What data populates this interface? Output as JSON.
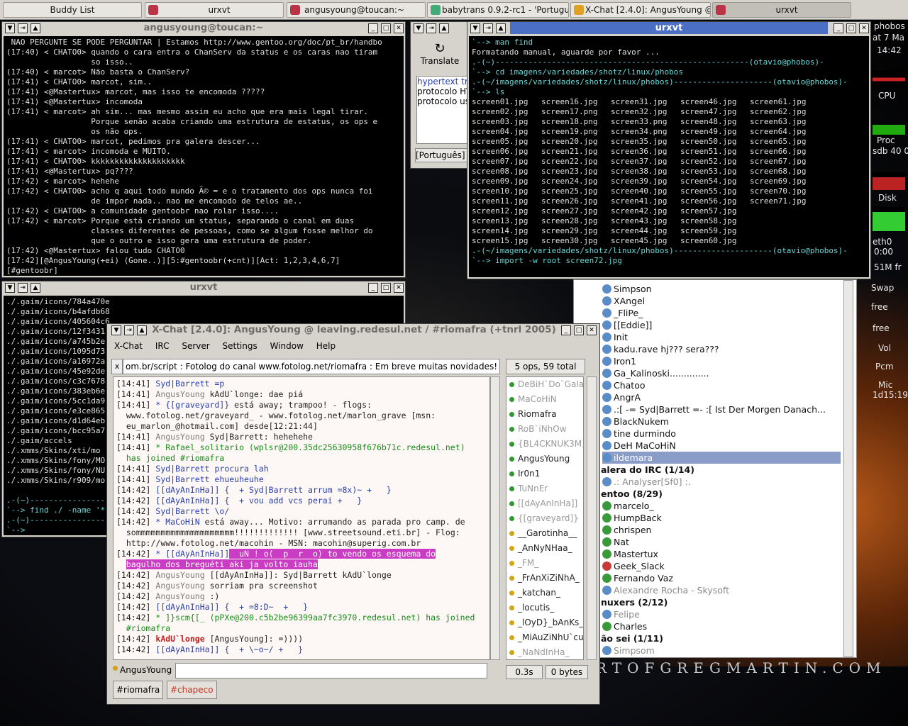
{
  "taskbar": {
    "tasks": [
      "Buddy List",
      "urxvt",
      "angusyoung@toucan:~",
      "babytrans 0.9.2-rc1 - 'Portugu",
      "X-Chat [2.4.0]: AngusYoung @",
      "urxvt"
    ]
  },
  "irc_term": {
    "title": "angusyoung@toucan:~",
    "lines": [
      " NAO PERGUNTE SE PODE PERGUNTAR | Estamos http://www.gentoo.org/doc/pt_br/handbo",
      "(17:40) < CHATO0> quando o cara entra o ChanServ da status e os caras nao tiram",
      "                  so isso..",
      "(17:40) < marcot> Não basta o ChanServ?",
      "(17:41) < CHATO0> marcot, sim..",
      "(17:41) <@Mastertux> marcot, mas isso te encomoda ?????",
      "(17:41) <@Mastertux> incomoda",
      "(17:41) < marcot> ah sim... mas mesmo assim eu acho que era mais legal tirar.",
      "                  Porque senão acaba criando uma estrutura de estatus, os ops e",
      "                  os não ops.",
      "(17:41) < CHATO0> marcot, pedimos pra galera descer...",
      "(17:41) < marcot> incomoda e MUITO.",
      "(17:41) < CHATO0> kkkkkkkkkkkkkkkkkkkk",
      "(17:41) <@Mastertux> pq????",
      "(17:42) < marcot> hehehe",
      "(17:42) < CHATO0> acho q aqui todo mundo Ã© = e o tratamento dos ops nunca foi",
      "                  de impor nada.. nao me encomodo de telos ae..",
      "(17:42) < CHATO0> a comunidade gentoobr nao rolar isso....",
      "(17:42) < marcot> Porque está criando um status, separando o canal em duas",
      "                  classes diferentes de pessoas, como se algum fosse melhor do",
      "                  que o outro e isso gera uma estrutura de poder.",
      "(17:42) <@Mastertux> falou tudo CHATO0",
      "[17:42][@AngusYoung(+ei) (Gone..)][5:#gentoobr(+cnt)][Act: 1,2,3,4,6,7]",
      "[#gentoobr] "
    ]
  },
  "find_term": {
    "title": "urxvt",
    "lines": [
      "./.gaim/icons/784a470e",
      "./.gaim/icons/b4afdb68",
      "./.gaim/icons/405604c6",
      "./.gaim/icons/12f3431",
      "./.gaim/icons/a745b2e",
      "./.gaim/icons/1095d73",
      "./.gaim/icons/a16972a",
      "./.gaim/icons/45e92de",
      "./.gaim/icons/c3c7678",
      "./.gaim/icons/383eb6e",
      "./.gaim/icons/5cc1da9",
      "./.gaim/icons/e3ce865",
      "./.gaim/icons/d1d64eb",
      "./.gaim/icons/bcc95a7",
      "./.gaim/accels",
      "./.xmms/Skins/xti/mo",
      "./.xmms/Skins/fony/MO",
      "./.xmms/Skins/fony/NU",
      "./.xmms/Skins/r909/mo",
      "",
      ".-(~)----------------",
      "`--> find ./ -name '*",
      ".-(~)----------------",
      "`--> "
    ]
  },
  "ls_term": {
    "title": "urxvt",
    "header_lines": [
      "`--> man find",
      "Formatando manual, aguarde por favor ...",
      ".-(~)------------------------------------------------------(otavio@phobos)-",
      "`--> cd imagens/variedades/shotz/linux/phobos",
      ".-(~/imagens/variedades/shotz/linux/phobos)---------------------(otavio@phobos)-",
      "`--> ls"
    ],
    "files": [
      [
        "screen01.jpg",
        "screen16.jpg",
        "screen31.jpg",
        "screen46.jpg",
        "screen61.jpg"
      ],
      [
        "screen02.jpg",
        "screen17.png",
        "screen32.jpg",
        "screen47.jpg",
        "screen62.jpg"
      ],
      [
        "screen03.jpg",
        "screen18.png",
        "screen33.png",
        "screen48.jpg",
        "screen63.jpg"
      ],
      [
        "screen04.jpg",
        "screen19.png",
        "screen34.png",
        "screen49.jpg",
        "screen64.jpg"
      ],
      [
        "screen05.jpg",
        "screen20.jpg",
        "screen35.jpg",
        "screen50.jpg",
        "screen65.jpg"
      ],
      [
        "screen06.jpg",
        "screen21.jpg",
        "screen36.jpg",
        "screen51.jpg",
        "screen66.jpg"
      ],
      [
        "screen07.jpg",
        "screen22.jpg",
        "screen37.jpg",
        "screen52.jpg",
        "screen67.jpg"
      ],
      [
        "screen08.jpg",
        "screen23.jpg",
        "screen38.jpg",
        "screen53.jpg",
        "screen68.jpg"
      ],
      [
        "screen09.jpg",
        "screen24.jpg",
        "screen39.jpg",
        "screen54.jpg",
        "screen69.jpg"
      ],
      [
        "screen10.jpg",
        "screen25.jpg",
        "screen40.jpg",
        "screen55.jpg",
        "screen70.jpg"
      ],
      [
        "screen11.jpg",
        "screen26.jpg",
        "screen41.jpg",
        "screen56.jpg",
        "screen71.jpg"
      ],
      [
        "screen12.jpg",
        "screen27.jpg",
        "screen42.jpg",
        "screen57.jpg",
        ""
      ],
      [
        "screen13.jpg",
        "screen28.jpg",
        "screen43.jpg",
        "screen58.jpg",
        ""
      ],
      [
        "screen14.jpg",
        "screen29.jpg",
        "screen44.jpg",
        "screen59.jpg",
        ""
      ],
      [
        "screen15.jpg",
        "screen30.jpg",
        "screen45.jpg",
        "screen60.jpg",
        ""
      ]
    ],
    "footer_lines": [
      ".-(~/imagens/variedades/shotz/linux/phobos)---------------------(otavio@phobos)-",
      "`--> import -w root screen72.jpg"
    ]
  },
  "babytrans": {
    "translate_label": "Translate",
    "results": [
      "hypertext tra",
      "protocolo HT",
      "protocolo us"
    ],
    "language": "[Português] -"
  },
  "xchat": {
    "title": "X-Chat [2.4.0]: AngusYoung @ leaving.redesul.net / #riomafra (+tnrl 2005)",
    "menu": [
      "X-Chat",
      "IRC",
      "Server",
      "Settings",
      "Window",
      "Help"
    ],
    "topic_close": "x",
    "topic": "om.br/script : Fotolog do canal www.fotolog.net/riomafra : Em breve muitas novidades!",
    "ops_summary": "5 ops, 59 total",
    "log": [
      {
        "t": "[14:41] ",
        "n": "Syd|Barrett",
        "nc": "nick-b",
        "m": " =p"
      },
      {
        "t": "[14:41] ",
        "n": "AngusYoung",
        "nc": "nick-g",
        "m": " kAdU`longe: dae piá"
      },
      {
        "t": "[14:41] ",
        "n": "* {[graveyard]}",
        "nc": "act",
        "m": " está away; trampoo! - flogs:"
      },
      {
        "t": "  ",
        "n": "",
        "nc": "",
        "m": "www.fotolog.net/graveyard_ - www.fotolog.net/marlon_grave [msn:"
      },
      {
        "t": "  ",
        "n": "",
        "nc": "",
        "m": "eu_marlon_@hotmail.com] desde[12:21:44]"
      },
      {
        "t": "[14:41] ",
        "n": "AngusYoung",
        "nc": "nick-g",
        "m": " Syd|Barrett: hehehehe"
      },
      {
        "t": "[14:41] ",
        "n": "* Rafael_solitario",
        "nc": "join",
        "m": " (wplsr@200.35dc25630958f676b71c.redesul.net)"
      },
      {
        "t": "  ",
        "n": "",
        "nc": "join",
        "m": "has joined #riomafra"
      },
      {
        "t": "[14:41] ",
        "n": "Syd|Barrett",
        "nc": "nick-b",
        "m": " procura lah"
      },
      {
        "t": "[14:41] ",
        "n": "Syd|Barrett",
        "nc": "nick-b",
        "m": " ehueuheuhe"
      },
      {
        "t": "[14:42] ",
        "n": "[[dAyAnInHa]]",
        "nc": "nick-b",
        "m": " {  + Syd|Barrett arrum =8x)~ +   }"
      },
      {
        "t": "[14:42] ",
        "n": "[[dAyAnInHa]]",
        "nc": "nick-b",
        "m": " {  + vou add vcs perai +   }"
      },
      {
        "t": "[14:42] ",
        "n": "Syd|Barrett",
        "nc": "nick-b",
        "m": " \\o/"
      },
      {
        "t": "[14:42] ",
        "n": "* MaCoHiN",
        "nc": "act",
        "m": " está away... Motivo: arrumando as parada pro camp. de"
      },
      {
        "t": "  ",
        "n": "",
        "nc": "",
        "m": "sommmmmmmmmmmmmmmmmmmm!!!!!!!!!!!!! [www.streetsound.eti.br] - Flog:"
      },
      {
        "t": "  ",
        "n": "",
        "nc": "",
        "m": "http://www.fotolog.net/macohin - MSN: macohin@superig.com.br"
      },
      {
        "t": "[14:42] ",
        "n": "* [[dAyAnInHa]]",
        "nc": "act",
        "m": "  uN ! o(  p  r  o) to vendo os esquema do"
      },
      {
        "t": "  ",
        "n": "",
        "nc": "sel-m",
        "m": "bagulho dos breguéti aki ja volto iauha"
      },
      {
        "t": "[14:42] ",
        "n": "AngusYoung",
        "nc": "nick-g",
        "m": " [[dAyAnInHa]]: Syd|Barrett kAdU`longe"
      },
      {
        "t": "[14:42] ",
        "n": "AngusYoung",
        "nc": "nick-g",
        "m": " sorriam pra screenshot"
      },
      {
        "t": "[14:42] ",
        "n": "AngusYoung",
        "nc": "nick-g",
        "m": " :)"
      },
      {
        "t": "[14:42] ",
        "n": "[[dAyAnInHa]]",
        "nc": "nick-b",
        "m": " {  + =8:D~  +   }"
      },
      {
        "t": "[14:42] ",
        "n": "* ]}scm{[_",
        "nc": "join",
        "m": " (pPXe@200.c5b2be96399aa7fc3970.redesul.net) has joined"
      },
      {
        "t": "  ",
        "n": "",
        "nc": "join",
        "m": "#riomafra"
      },
      {
        "t": "[14:42] ",
        "n": "kAdU`longe",
        "nc": "nick-r",
        "m": " [AngusYoung]: =))))"
      },
      {
        "t": "[14:42] ",
        "n": "[[dAyAnInHa]]",
        "nc": "nick-b",
        "m": " {  + \\~o~/ +   }"
      }
    ],
    "users": [
      {
        "n": "DeBiH`Do`Gala",
        "c": "gr"
      },
      {
        "n": "MaCoHiN",
        "c": "gr"
      },
      {
        "n": "Riomafra",
        "c": ""
      },
      {
        "n": "RoB`iNhOw",
        "c": "gr"
      },
      {
        "n": "{BL4CKNUK3M}",
        "c": "gr"
      },
      {
        "n": "AngusYoung",
        "c": ""
      },
      {
        "n": "Ir0n1",
        "c": ""
      },
      {
        "n": "TuNnEr",
        "c": "gr"
      },
      {
        "n": "[[dAyAnInHa]]",
        "c": "gr"
      },
      {
        "n": "{[graveyard]}",
        "c": "gr"
      },
      {
        "n": "__Garotinha__",
        "c": ""
      },
      {
        "n": "_AnNyNHaa_",
        "c": ""
      },
      {
        "n": "_FM_",
        "c": "gr"
      },
      {
        "n": "_FrAnXiZiNhA_",
        "c": ""
      },
      {
        "n": "_katchan_",
        "c": ""
      },
      {
        "n": "_locutis_",
        "c": ""
      },
      {
        "n": "_lOyD}_bAnKs_",
        "c": ""
      },
      {
        "n": "_MiAuZiNhU`cu",
        "c": ""
      },
      {
        "n": "_NaNdInHa_",
        "c": "gr"
      }
    ],
    "nick_label": "AngusYoung",
    "lag": "0.3s",
    "bytes": "0 bytes",
    "tabs": [
      "#riomafra",
      "#chapeco"
    ]
  },
  "buddy_list": {
    "items": [
      {
        "t": "Simpson",
        "k": "b"
      },
      {
        "t": "XAngel",
        "k": "b"
      },
      {
        "t": "_FliPe_",
        "k": "b"
      },
      {
        "t": "[[Eddie]]",
        "k": "b"
      },
      {
        "t": "Init",
        "k": "b"
      },
      {
        "t": "kadu.rave hj??? sera???",
        "k": "b"
      },
      {
        "t": "Iron1",
        "k": "b"
      },
      {
        "t": "Ga_Kalinoski..............",
        "k": "b"
      },
      {
        "t": "Chatoo",
        "k": "b"
      },
      {
        "t": "AngrA",
        "k": "b"
      },
      {
        "t": ".:[ -= Syd|Barrett =- :[ Ist Der Morgen Danach...",
        "k": "b"
      },
      {
        "t": "BlackNukem",
        "k": "b"
      },
      {
        "t": "tine durmindo",
        "k": "b"
      },
      {
        "t": "DeH MaCoHiN",
        "k": "b"
      },
      {
        "t": "ildemara",
        "k": "sel"
      },
      {
        "t": "alera do IRC (1/14)",
        "k": "grp"
      },
      {
        "t": ".: Analyser[Sf0] :.",
        "k": "gry"
      },
      {
        "t": "entoo (8/29)",
        "k": "grp"
      },
      {
        "t": "marcelo_",
        "k": "g"
      },
      {
        "t": "HumpBack",
        "k": "g"
      },
      {
        "t": "chrispen",
        "k": "g"
      },
      {
        "t": "Nat",
        "k": "g"
      },
      {
        "t": "Mastertux",
        "k": "g"
      },
      {
        "t": "Geek_Slack",
        "k": "r"
      },
      {
        "t": "Fernando Vaz",
        "k": "g"
      },
      {
        "t": "Alexandre Rocha - Skysoft",
        "k": "gry"
      },
      {
        "t": "nuxers (2/12)",
        "k": "grp"
      },
      {
        "t": "Felipe",
        "k": "gry"
      },
      {
        "t": "Charles",
        "k": "g"
      },
      {
        "t": "ão sei (1/11)",
        "k": "grp"
      },
      {
        "t": "Simpsom",
        "k": "gry"
      }
    ]
  },
  "gkrellm": {
    "host": "phobos",
    "date": "at  7 Ma",
    "time": "14:42",
    "cpu": "CPU",
    "proc": "Proc",
    "sdb": "sdb 40 0",
    "disk": "Disk",
    "eth": "eth0",
    "eth_time": "0:00",
    "mem": "51M fr",
    "swap": "Swap",
    "free1": "free",
    "free2": "free",
    "vol": "Vol",
    "pcm": "Pcm",
    "mic": "Mic",
    "uptime": "1d15:19"
  },
  "wallpaper_text": "RTOFGREGMARTIN.COM"
}
